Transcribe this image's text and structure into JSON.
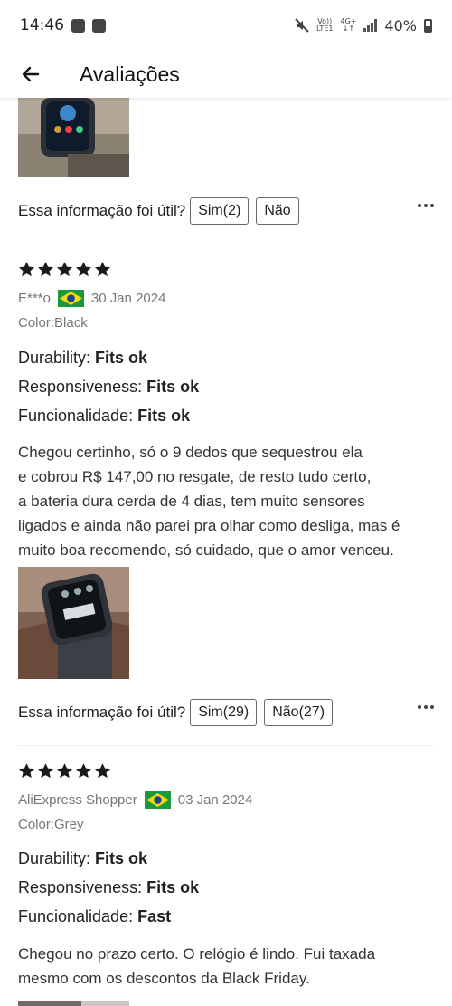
{
  "status_bar": {
    "time": "14:46",
    "network_top": "Vo))",
    "network_bottom": "LTE1",
    "network_type": "4G+",
    "battery": "40%"
  },
  "header": {
    "title": "Avaliações"
  },
  "review_prev": {
    "helpful_label": "Essa informação foi útil?",
    "yes_label": "Sim(2)",
    "no_label": "Não"
  },
  "review_1": {
    "rating": 5,
    "author": "E***o",
    "country_flag": "brazil-flag-icon",
    "date": "30 Jan 2024",
    "color": "Color:Black",
    "attributes": [
      {
        "name": "Durability: ",
        "value": "Fits ok"
      },
      {
        "name": "Responsiveness: ",
        "value": "Fits ok"
      },
      {
        "name": "Funcionalidade: ",
        "value": "Fits ok"
      }
    ],
    "text_lines": [
      "Chegou certinho, só o 9 dedos que sequestrou ela",
      "e cobrou R$ 147,00 no resgate, de resto tudo certo,",
      "a bateria dura cerda de 4 dias, tem muito sensores",
      "ligados e ainda não parei pra olhar como desliga, mas é",
      "muito boa recomendo, só cuidado, que o amor venceu."
    ],
    "helpful_label": "Essa informação foi útil?",
    "yes_label": "Sim(29)",
    "no_label": "Não(27)"
  },
  "review_2": {
    "rating": 5,
    "author": "AliExpress Shopper",
    "country_flag": "brazil-flag-icon",
    "date": "03 Jan 2024",
    "color": "Color:Grey",
    "attributes": [
      {
        "name": "Durability: ",
        "value": "Fits ok"
      },
      {
        "name": "Responsiveness: ",
        "value": "Fits ok"
      },
      {
        "name": "Funcionalidade: ",
        "value": "Fast"
      }
    ],
    "text_lines": [
      "Chegou no prazo certo. O relógio é lindo. Fui taxada",
      "mesmo com os descontos da Black Friday."
    ]
  },
  "colors": {
    "star": "#1a1a1a",
    "flag_green": "#199a3a",
    "flag_yellow": "#f5d90b",
    "flag_blue": "#1f3f9a"
  }
}
